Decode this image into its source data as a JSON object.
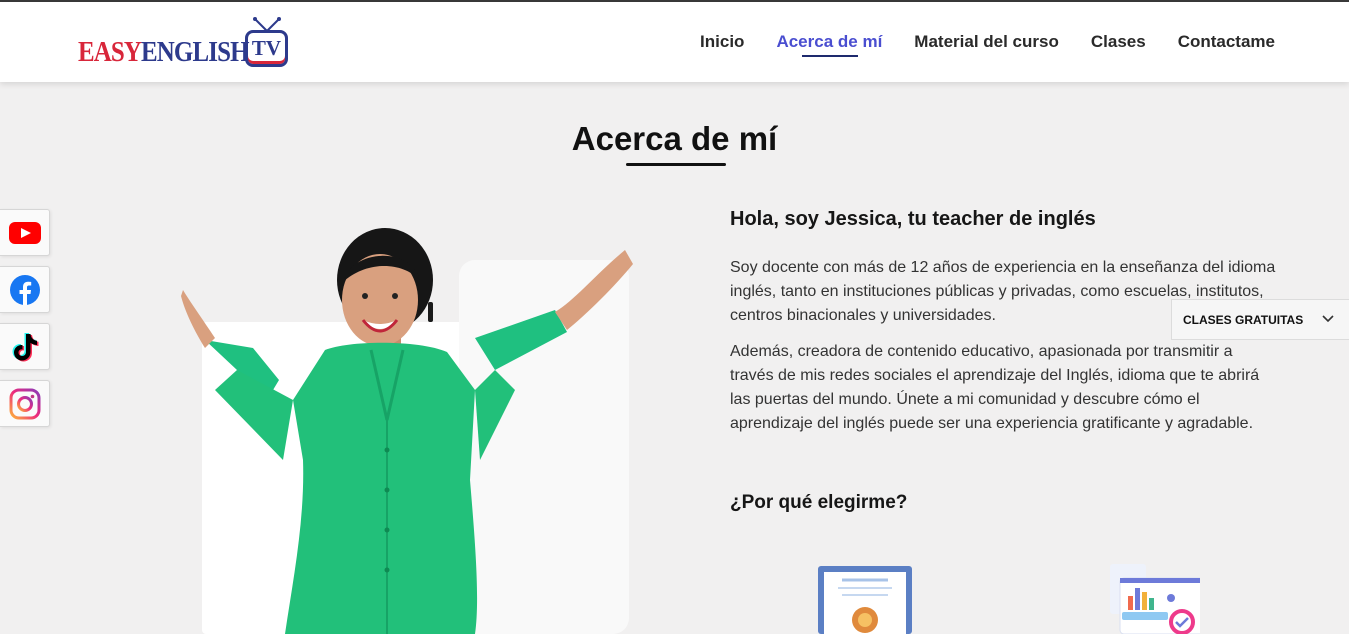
{
  "brand": {
    "easy": "EASY",
    "english": "ENGLISH",
    "tv": "TV"
  },
  "nav": {
    "items": [
      {
        "label": "Inicio",
        "active": false
      },
      {
        "label": "Acerca de mí",
        "active": true
      },
      {
        "label": "Material del curso",
        "active": false
      },
      {
        "label": "Clases",
        "active": false
      },
      {
        "label": "Contactame",
        "active": false
      }
    ]
  },
  "page": {
    "title": "Acerca de mí"
  },
  "social": [
    {
      "name": "youtube-icon",
      "color": "#ff0000"
    },
    {
      "name": "facebook-icon",
      "color": "#1877f2"
    },
    {
      "name": "tiktok-icon",
      "color": "#000000"
    },
    {
      "name": "instagram-icon",
      "color": "#e1306c"
    }
  ],
  "content": {
    "intro": "Hola, soy Jessica, tu teacher de inglés",
    "paragraph1": "Soy docente con más de 12 años de experiencia en la enseñanza del idioma inglés, tanto en instituciones públicas y privadas, como escuelas, institutos, centros binacionales y universidades.",
    "paragraph2": "Además, creadora de contenido educativo, apasionada por transmitir a través de mis redes sociales el aprendizaje del Inglés, idioma que te abrirá las puertas del mundo. Únete a mi comunidad y descubre cómo el aprendizaje del inglés puede ser una experiencia gratificante y agradable.",
    "why": "¿Por qué elegirme?"
  },
  "dropdown": {
    "label": "CLASES GRATUITAS"
  },
  "colors": {
    "accent": "#4a4ed0",
    "navy": "#2d3a8c",
    "red": "#d8263a",
    "dress": "#22c07a"
  }
}
